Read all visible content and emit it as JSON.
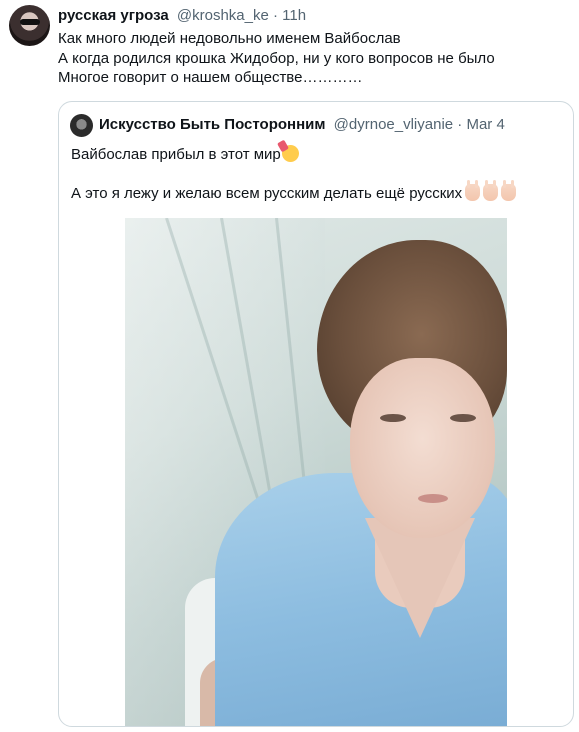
{
  "tweet": {
    "author_name": "русская угроза",
    "author_handle": "@kroshka_ke",
    "separator": "·",
    "time": "11h",
    "lines": [
      "Как много людей недовольно именем Вайбослав",
      "А когда родился крошка Жидобор, ни у кого вопросов не было",
      "Многое говорит о нашем обществе…………"
    ]
  },
  "quote": {
    "author_name": "Искусство Быть Посторонним",
    "author_handle": "@dyrnoe_vliyanie",
    "separator": "·",
    "time": "Mar 4",
    "line1": "Вайбослав прибыл в этот мир",
    "line2": "А это я  лежу и желаю всем русским делать ещё русских",
    "icons": [
      "party-face-emoji",
      "rock-on-hand-emoji"
    ]
  },
  "colors": {
    "text": "#0f1419",
    "secondary": "#536471",
    "border": "#cfd9de"
  }
}
